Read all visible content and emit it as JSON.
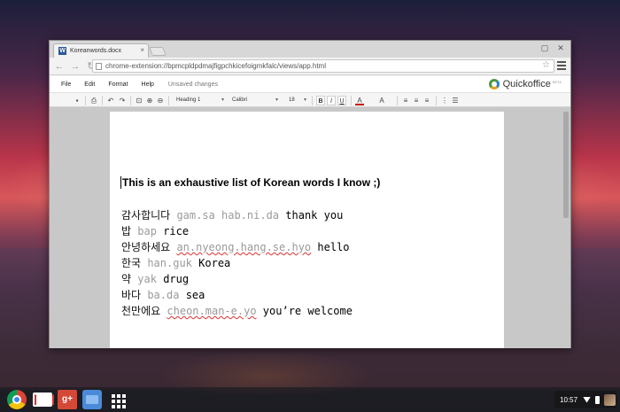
{
  "browser": {
    "tab_title": "Koreanwords.docx",
    "tab_icon": "W",
    "url": "chrome-extension://bpmcpldpdmajfigpchkicefoigmkfalc/views/app.html"
  },
  "menubar": {
    "items": [
      "File",
      "Edit",
      "Format",
      "Help"
    ],
    "status": "Unsaved changes",
    "brand": "Quickoffice",
    "brand_tag": "BETA"
  },
  "formatbar": {
    "style": "Heading 1",
    "font": "Calibri",
    "size": "18",
    "bold": "B",
    "italic": "I",
    "underline": "U",
    "font_color": "A",
    "highlight": "A"
  },
  "document": {
    "title": "This is an exhaustive list of Korean words I know ;)",
    "entries": [
      {
        "korean": "감사합니다",
        "roman": "gam.sa hab.ni.da",
        "english": "thank you"
      },
      {
        "korean": "밥",
        "roman": "bap",
        "english": "rice"
      },
      {
        "korean": "안녕하세요",
        "roman": "an.nyeong.hang.se.hyo",
        "english": "hello"
      },
      {
        "korean": "한국",
        "roman": "han.guk",
        "english": "Korea"
      },
      {
        "korean": "약",
        "roman": "yak",
        "english": "drug"
      },
      {
        "korean": "바다",
        "roman": "ba.da",
        "english": "sea"
      },
      {
        "korean": "천만에요",
        "roman": "cheon.man-e.yo",
        "english": "you’re welcome"
      }
    ]
  },
  "shelf": {
    "clock": "10:57",
    "apps": [
      "chrome-icon",
      "gmail-icon",
      "google-plus-icon",
      "files-icon",
      "app-launcher-icon"
    ],
    "gplus_label": "g+"
  }
}
